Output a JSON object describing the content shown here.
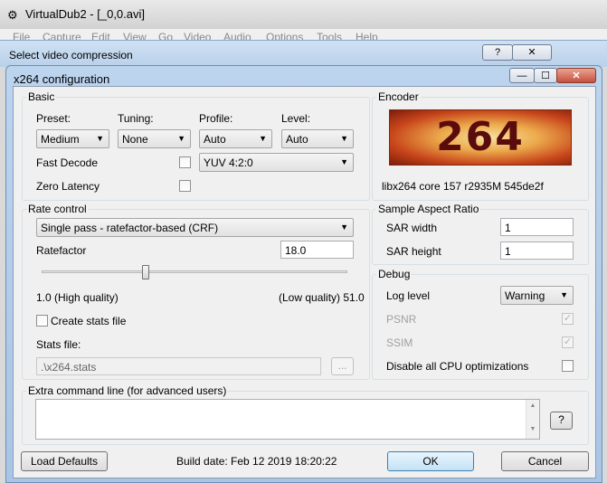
{
  "vd": {
    "title": "VirtualDub2  - [_0,0.avi]",
    "icon": "gear-icon",
    "menu": [
      "File",
      "Capture",
      "Edit",
      "View",
      "Go",
      "Video",
      "Audio",
      "Options",
      "Tools",
      "Help"
    ]
  },
  "svc": {
    "title": "Select video compression",
    "help": "?",
    "close": "✕"
  },
  "x264": {
    "title": "x264 configuration",
    "min": "—",
    "max": "☐",
    "close": "✕"
  },
  "basic": {
    "label": "Basic",
    "preset_label": "Preset:",
    "tuning_label": "Tuning:",
    "profile_label": "Profile:",
    "level_label": "Level:",
    "preset": "Medium",
    "tuning": "None",
    "profile": "Auto",
    "level": "Auto",
    "fast_decode": "Fast Decode",
    "colorspace": "YUV 4:2:0",
    "zero_latency": "Zero Latency"
  },
  "encoder": {
    "label": "Encoder",
    "logo_text": "264",
    "version": "libx264 core 157 r2935M 545de2f"
  },
  "rate": {
    "label": "Rate control",
    "mode": "Single pass - ratefactor-based (CRF)",
    "ratefactor_label": "Ratefactor",
    "ratefactor": "18.0",
    "slider_value": 18.0,
    "slider_min": 1.0,
    "slider_max": 51.0,
    "min_label": "1.0 (High quality)",
    "max_label": "(Low quality) 51.0",
    "create_stats": "Create stats file",
    "stats_label": "Stats file:",
    "stats_file": ".\\x264.stats",
    "browse": "..."
  },
  "sar": {
    "label": "Sample Aspect Ratio",
    "width_label": "SAR width",
    "width": "1",
    "height_label": "SAR height",
    "height": "1"
  },
  "debug": {
    "label": "Debug",
    "log_level_label": "Log level",
    "log_level": "Warning",
    "psnr": "PSNR",
    "ssim": "SSIM",
    "disable_cpu": "Disable all CPU optimizations"
  },
  "extra": {
    "label": "Extra command line (for advanced users)",
    "help": "?"
  },
  "footer": {
    "load_defaults": "Load Defaults",
    "build_date": "Build date: Feb 12 2019 18:20:22",
    "ok": "OK",
    "cancel": "Cancel"
  }
}
